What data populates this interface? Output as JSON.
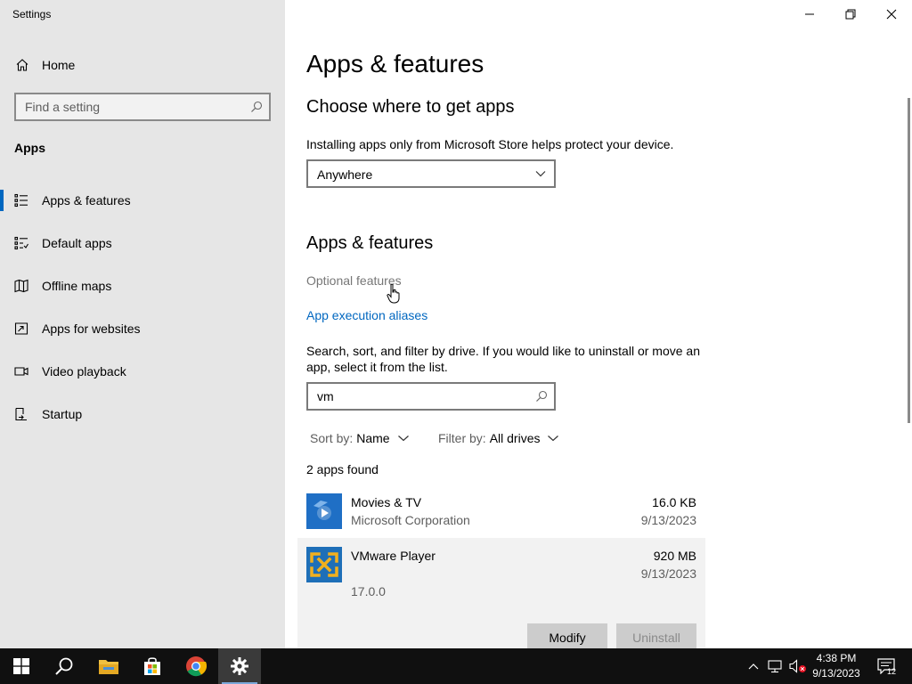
{
  "window": {
    "title": "Settings"
  },
  "sidebar": {
    "home_label": "Home",
    "search_placeholder": "Find a setting",
    "section_label": "Apps",
    "items": [
      {
        "label": "Apps & features",
        "icon": "list-icon",
        "active": true
      },
      {
        "label": "Default apps",
        "icon": "default-apps-icon",
        "active": false
      },
      {
        "label": "Offline maps",
        "icon": "map-icon",
        "active": false
      },
      {
        "label": "Apps for websites",
        "icon": "open-external-icon",
        "active": false
      },
      {
        "label": "Video playback",
        "icon": "video-icon",
        "active": false
      },
      {
        "label": "Startup",
        "icon": "startup-icon",
        "active": false
      }
    ]
  },
  "main": {
    "page_title": "Apps & features",
    "choose_heading": "Choose where to get apps",
    "choose_description": "Installing apps only from Microsoft Store helps protect your device.",
    "source_selected": "Anywhere",
    "apps_heading": "Apps & features",
    "optional_features_link": "Optional features",
    "aliases_link": "App execution aliases",
    "search_description": "Search, sort, and filter by drive. If you would like to uninstall or move an app, select it from the list.",
    "search_value": "vm",
    "sort_label": "Sort by:",
    "sort_value": "Name",
    "filter_label": "Filter by:",
    "filter_value": "All drives",
    "apps_found": "2 apps found",
    "apps": [
      {
        "name": "Movies & TV",
        "publisher": "Microsoft Corporation",
        "size": "16.0 KB",
        "date": "9/13/2023"
      },
      {
        "name": "VMware Player",
        "version": "17.0.0",
        "size": "920 MB",
        "date": "9/13/2023"
      }
    ],
    "modify_label": "Modify",
    "uninstall_label": "Uninstall"
  },
  "taskbar": {
    "time": "4:38 PM",
    "date": "9/13/2023",
    "notification_count": "12"
  },
  "colors": {
    "accent": "#0067c0",
    "sidebar_bg": "#e6e6e6",
    "taskbar_bg": "#101010"
  }
}
